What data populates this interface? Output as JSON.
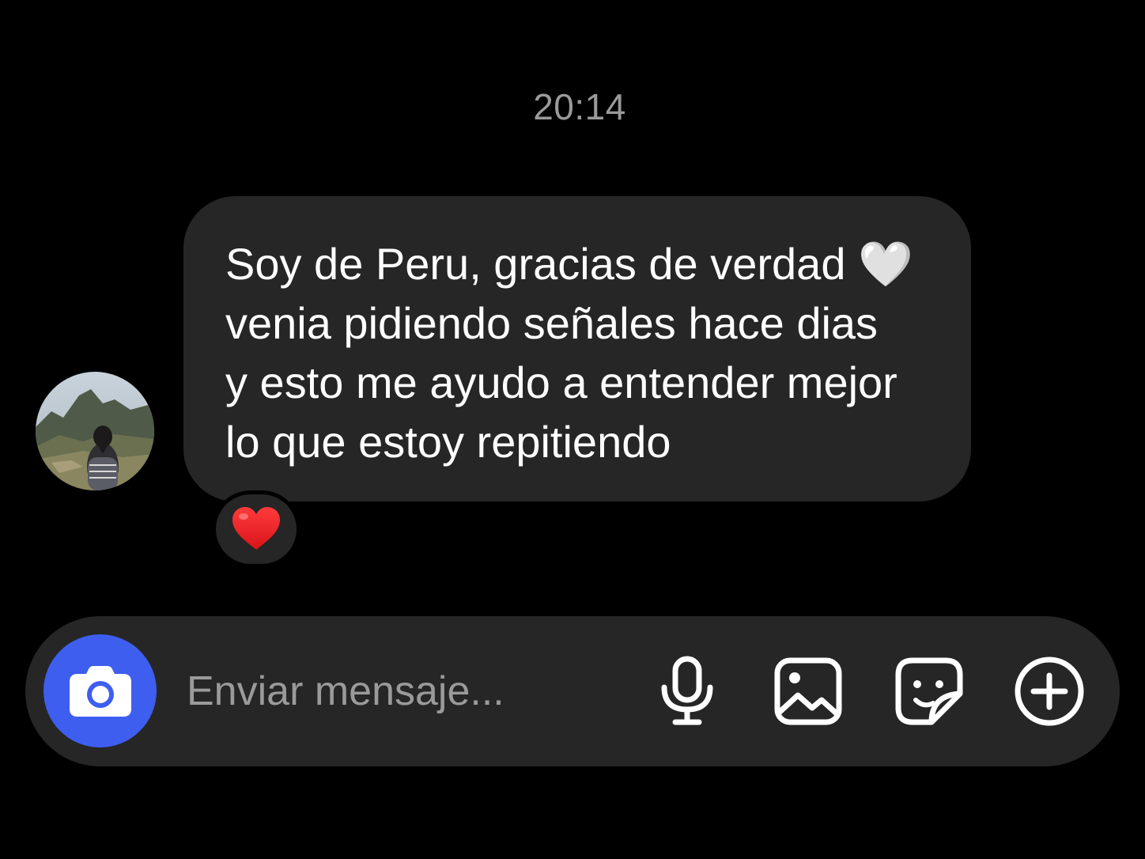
{
  "thread": {
    "timestamp": "20:14"
  },
  "message": {
    "text": "Soy de Peru, gracias de verdad 🤍\nvenia pidiendo señales hace dias\ny esto me ayudo a entender mejor\nlo que estoy repitiendo",
    "reaction": "❤️"
  },
  "composer": {
    "placeholder": "Enviar mensaje...",
    "icons": [
      "camera-icon",
      "microphone-icon",
      "gallery-icon",
      "sticker-icon",
      "plus-icon"
    ]
  },
  "colors": {
    "background": "#000000",
    "bubble": "#262626",
    "accent": "#3e5ef0",
    "muted_text": "#9a9a9a"
  }
}
